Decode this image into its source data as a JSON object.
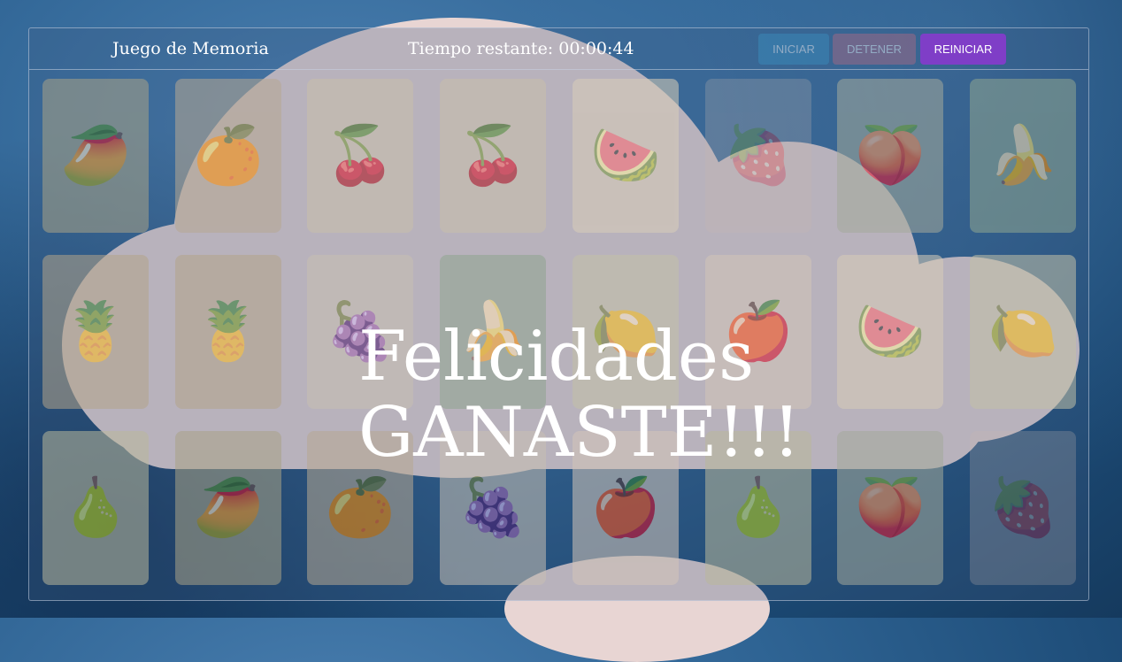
{
  "header": {
    "title": "Juego de Memoria",
    "timer_label": "Tiempo restante: 00:00:44"
  },
  "controls": {
    "start_label": "INICIAR",
    "stop_label": "DETENER",
    "reset_label": "REINICIAR"
  },
  "message": {
    "line1": "Felicidades",
    "line2": "GANASTE!!!"
  },
  "colors": {
    "start_button": "#3b8fc0",
    "stop_button": "#b06a84",
    "reset_button": "#7f3ec7",
    "background": "#2f6494",
    "cloud": "#e8d5d3"
  },
  "board": {
    "rows": [
      [
        "mango",
        "orange",
        "cherry",
        "cherry",
        "watermelon",
        "strawberry",
        "peach",
        "banana"
      ],
      [
        "pineapple",
        "pineapple",
        "grape",
        "banana",
        "lemon",
        "apple",
        "watermelon",
        "lemon"
      ],
      [
        "pear",
        "mango",
        "orange",
        "grape",
        "apple",
        "pear",
        "peach",
        "strawberry"
      ]
    ]
  }
}
